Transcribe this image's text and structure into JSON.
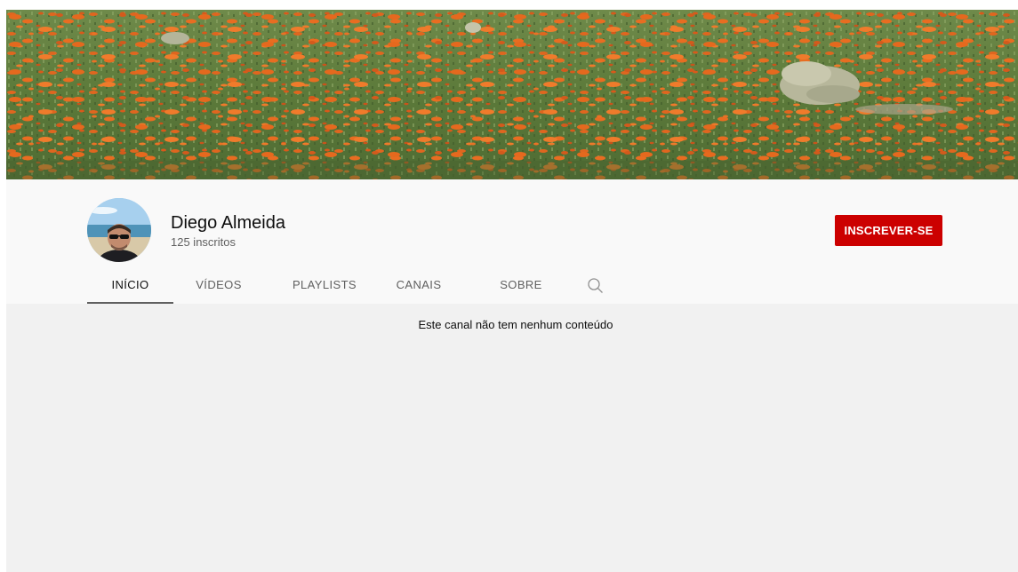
{
  "channel": {
    "name": "Diego Almeida",
    "subscribers": "125 inscritos",
    "subscribe_label": "INSCREVER-SE"
  },
  "tabs": [
    {
      "label": "INÍCIO",
      "active": true
    },
    {
      "label": "VÍDEOS",
      "active": false
    },
    {
      "label": "PLAYLISTS",
      "active": false
    },
    {
      "label": "CANAIS",
      "active": false
    },
    {
      "label": "SOBRE",
      "active": false
    }
  ],
  "search_icon": "search-icon",
  "content": {
    "empty_message": "Este canal não tem nenhum conteúdo"
  },
  "colors": {
    "subscribe": "#cc0000",
    "header_bg": "#f9f9f9",
    "content_bg": "#f1f1f1",
    "active_tab_underline": "#606060"
  }
}
